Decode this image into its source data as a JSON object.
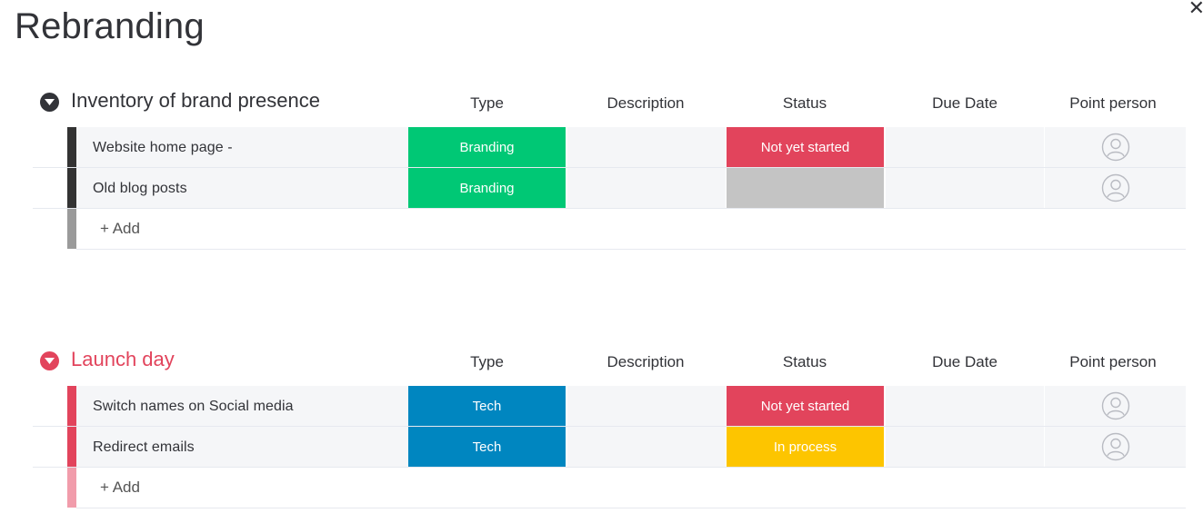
{
  "board": {
    "title": "Rebranding",
    "close_icon": "close-icon"
  },
  "columns": [
    "Type",
    "Description",
    "Status",
    "Due Date",
    "Point person"
  ],
  "groups": [
    {
      "name": "Inventory of brand presence",
      "color": "#323338",
      "stripe_color": "#333333",
      "add_stripe_color": "#9a9a9a",
      "add_label": "+ Add",
      "rows": [
        {
          "name": "Website home page -",
          "type": "Branding",
          "type_color": "#00c875",
          "description": "",
          "status": "Not yet started",
          "status_color": "#e2445c",
          "due_date": "",
          "person_icon": "person-icon"
        },
        {
          "name": "Old blog posts",
          "type": "Branding",
          "type_color": "#00c875",
          "description": "",
          "status": "",
          "status_color": "#c4c4c4",
          "due_date": "",
          "person_icon": "person-icon"
        }
      ]
    },
    {
      "name": "Launch day",
      "color": "#e2445c",
      "stripe_color": "#e2445c",
      "add_stripe_color": "#f19cab",
      "add_label": "+ Add",
      "rows": [
        {
          "name": "Switch names on Social media",
          "type": "Tech",
          "type_color": "#0086c0",
          "description": "",
          "status": "Not yet started",
          "status_color": "#e2445c",
          "due_date": "",
          "person_icon": "person-icon"
        },
        {
          "name": "Redirect emails",
          "type": "Tech",
          "type_color": "#0086c0",
          "description": "",
          "status": "In process",
          "status_color": "#fdc500",
          "due_date": "",
          "person_icon": "person-icon"
        }
      ]
    }
  ]
}
